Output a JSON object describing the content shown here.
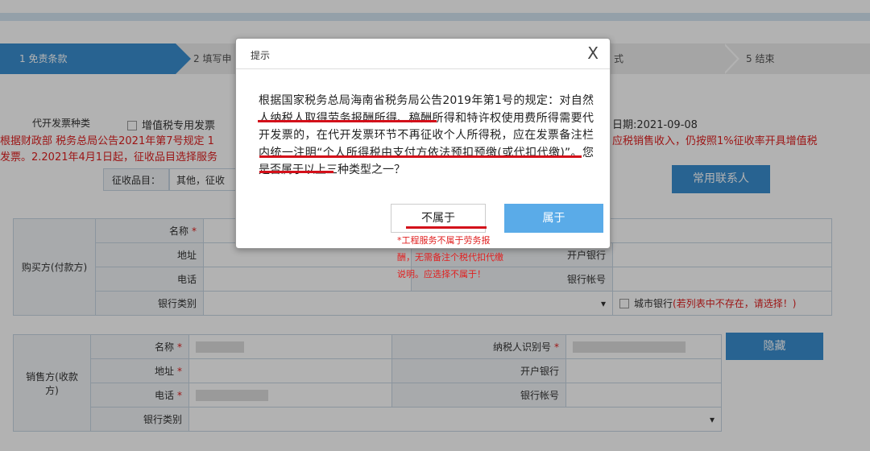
{
  "steps": [
    {
      "label": "1 免责条款",
      "active": true
    },
    {
      "label": "2 填写申",
      "active": false
    },
    {
      "label": "式",
      "active": false
    },
    {
      "label": "5 结束",
      "active": false
    }
  ],
  "invoice_type": {
    "label": "代开发票种类",
    "option": "增值税专用发票",
    "date": "日期:2021-09-08"
  },
  "notice_lines": [
    "根据财政部 税务总局公告2021年第7号规定 1",
    "应税销售收入，仍按照1%征收率开具增值税",
    "发票。2.2021年4月1日起，征收品目选择服务"
  ],
  "category": {
    "label": "征收品目：",
    "value": "其他，征收"
  },
  "contacts_button": "常用联系人",
  "buyer": {
    "section": "购买方(付款方)",
    "name_label": "名称",
    "address_label": "地址",
    "phone_label": "电话",
    "bank_type_label": "银行类别",
    "bank_label": "开户银行",
    "account_label": "银行帐号",
    "city_bank_label": "城市银行",
    "city_bank_hint": "(若列表中不存在，请选择！)"
  },
  "seller": {
    "section": "销售方(收款方)",
    "name_label": "名称",
    "address_label": "地址",
    "phone_label": "电话",
    "bank_type_label": "银行类别",
    "taxid_label": "纳税人识别号",
    "bank_label": "开户银行",
    "account_label": "银行帐号",
    "hide_button": "隐藏"
  },
  "modal": {
    "title": "提示",
    "close": "X",
    "body": "根据国家税务总局海南省税务局公告2019年第1号的规定：对自然人纳税人取得劳务报酬所得、稿酬所得和特许权使用费所得需要代开发票的，在代开发票环节不再征收个人所得税，应在发票备注栏内统一注明“个人所得税由支付方依法预扣预缴(或代扣代缴)”。您是否属于以上三种类型之一？",
    "no_button": "不属于",
    "yes_button": "属于"
  },
  "annotation": "*工程服务不属于劳务报酬，无需备注个税代扣代缴说明。应选择不属于！",
  "colors": {
    "accent": "#3a8fd0",
    "alert": "#e02020",
    "underline": "#d3101a",
    "confirm": "#5aabe8"
  }
}
